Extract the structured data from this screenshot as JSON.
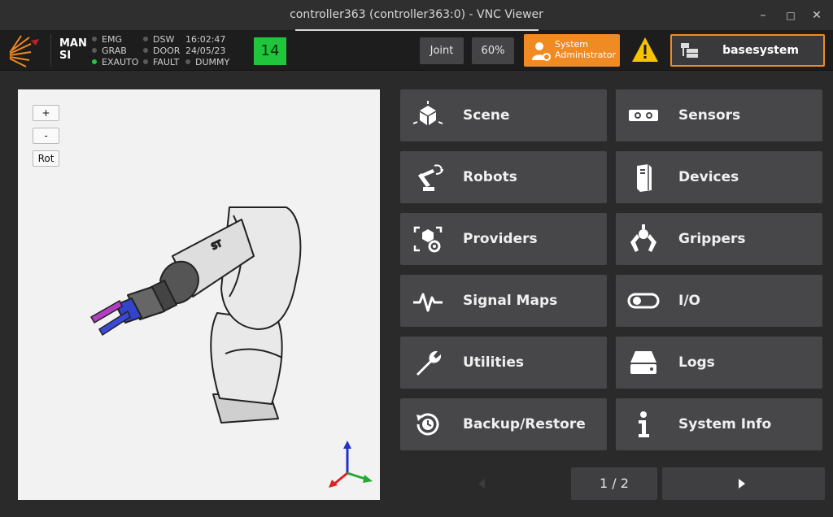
{
  "window": {
    "title": "controller363 (controller363:0) - VNC Viewer",
    "minimize": "–",
    "maximize": "□",
    "close": "✕"
  },
  "header": {
    "mode_line1": "MAN",
    "mode_line2": "SI",
    "status_col1": [
      {
        "label": "EMG",
        "active": false
      },
      {
        "label": "GRAB",
        "active": false
      },
      {
        "label": "EXAUTO",
        "active": true
      }
    ],
    "status_col2": [
      {
        "label": "DSW",
        "active": false
      },
      {
        "label": "DOOR",
        "active": false
      },
      {
        "label": "FAULT",
        "active": false
      },
      {
        "label": "DUMMY",
        "active": false
      }
    ],
    "time": "16:02:47",
    "date": "24/05/23",
    "counter": "14",
    "jog_mode": "Joint",
    "speed": "60%",
    "user_line1": "System",
    "user_line2": "Administrator",
    "system_name": "basesystem"
  },
  "viewport": {
    "zoom_in": "+",
    "zoom_out": "-",
    "rotate": "Rot"
  },
  "menu": [
    {
      "label": "Scene",
      "icon": "scene-icon"
    },
    {
      "label": "Sensors",
      "icon": "sensors-icon"
    },
    {
      "label": "Robots",
      "icon": "robot-arm-icon"
    },
    {
      "label": "Devices",
      "icon": "devices-icon"
    },
    {
      "label": "Providers",
      "icon": "providers-icon"
    },
    {
      "label": "Grippers",
      "icon": "gripper-icon"
    },
    {
      "label": "Signal Maps",
      "icon": "signal-icon"
    },
    {
      "label": "I/O",
      "icon": "toggle-icon"
    },
    {
      "label": "Utilities",
      "icon": "wrench-icon"
    },
    {
      "label": "Logs",
      "icon": "drive-icon"
    },
    {
      "label": "Backup/Restore",
      "icon": "restore-icon"
    },
    {
      "label": "System Info",
      "icon": "info-icon"
    }
  ],
  "pager": {
    "page": "1 / 2"
  },
  "colors": {
    "accent": "#f08a22",
    "counter": "#20c53c",
    "tile": "#47474a",
    "status_on": "#29c24a"
  }
}
